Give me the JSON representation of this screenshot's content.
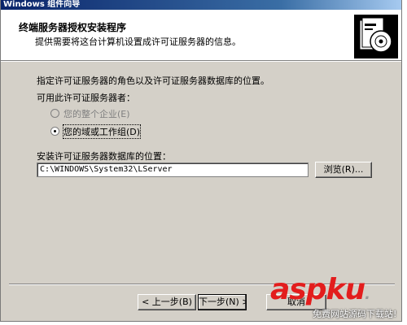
{
  "window": {
    "title": "Windows 组件向导"
  },
  "header": {
    "title": "终端服务器授权安装程序",
    "subtitle": "提供需要将这台计算机设置成许可证服务器的信息。",
    "icon": "cd-box-icon"
  },
  "body": {
    "instruction": "指定许可证服务器的角色以及许可证服务器数据库的位置。",
    "role_label": "可用此许可证服务器者：",
    "options": [
      {
        "label": "您的整个企业(E)",
        "selected": false,
        "enabled": false
      },
      {
        "label": "您的域或工作组(D)",
        "selected": true,
        "enabled": true
      }
    ],
    "db_label": "安装许可证服务器数据库的位置：",
    "db_path": "C:\\WINDOWS\\System32\\LServer",
    "browse_label": "浏览(R)..."
  },
  "footer": {
    "back_label": "< 上一步(B)",
    "next_label": "下一步(N) >",
    "cancel_label": "取消"
  },
  "watermark": {
    "main": "asp",
    "accent": "ku",
    "dot": ".",
    "sub": "免费网站源码下载站!"
  }
}
